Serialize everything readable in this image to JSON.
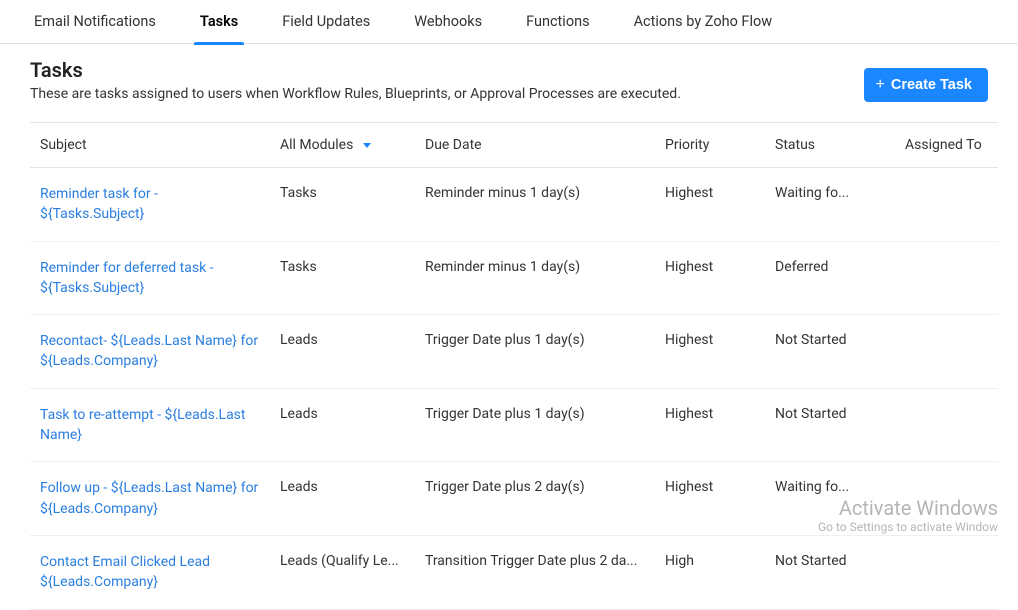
{
  "tabs": {
    "items": [
      {
        "label": "Email Notifications",
        "active": false
      },
      {
        "label": "Tasks",
        "active": true
      },
      {
        "label": "Field Updates",
        "active": false
      },
      {
        "label": "Webhooks",
        "active": false
      },
      {
        "label": "Functions",
        "active": false
      },
      {
        "label": "Actions by Zoho Flow",
        "active": false
      }
    ]
  },
  "page": {
    "title": "Tasks",
    "description": "These are tasks assigned to users when Workflow Rules, Blueprints, or Approval Processes are executed."
  },
  "create_button": {
    "label": "Create Task"
  },
  "columns": {
    "subject": "Subject",
    "module_filter": "All Modules",
    "due_date": "Due Date",
    "priority": "Priority",
    "status": "Status",
    "assigned_to": "Assigned To"
  },
  "rows": [
    {
      "subject": "Reminder task for - ${Tasks.Subject}",
      "module": "Tasks",
      "due_date": "Reminder minus 1 day(s)",
      "priority": "Highest",
      "status": "Waiting fo...",
      "assigned_to": ""
    },
    {
      "subject": "Reminder for deferred task - ${Tasks.Subject}",
      "module": "Tasks",
      "due_date": "Reminder minus 1 day(s)",
      "priority": "Highest",
      "status": "Deferred",
      "assigned_to": ""
    },
    {
      "subject": "Recontact- ${Leads.Last Name} for ${Leads.Company}",
      "module": "Leads",
      "due_date": "Trigger Date plus 1 day(s)",
      "priority": "Highest",
      "status": "Not Started",
      "assigned_to": ""
    },
    {
      "subject": "Task to re-attempt - ${Leads.Last Name}",
      "module": "Leads",
      "due_date": "Trigger Date plus 1 day(s)",
      "priority": "Highest",
      "status": "Not Started",
      "assigned_to": ""
    },
    {
      "subject": "Follow up - ${Leads.Last Name} for ${Leads.Company}",
      "module": "Leads",
      "due_date": "Trigger Date plus 2 day(s)",
      "priority": "Highest",
      "status": "Waiting fo...",
      "assigned_to": ""
    },
    {
      "subject": "Contact Email Clicked Lead ${Leads.Company}",
      "module": "Leads (Qualify Le...",
      "due_date": "Transition Trigger Date plus 2 da...",
      "priority": "High",
      "status": "Not Started",
      "assigned_to": ""
    }
  ],
  "watermark": {
    "line1": "Activate Windows",
    "line2": "Go to Settings to activate Window"
  }
}
